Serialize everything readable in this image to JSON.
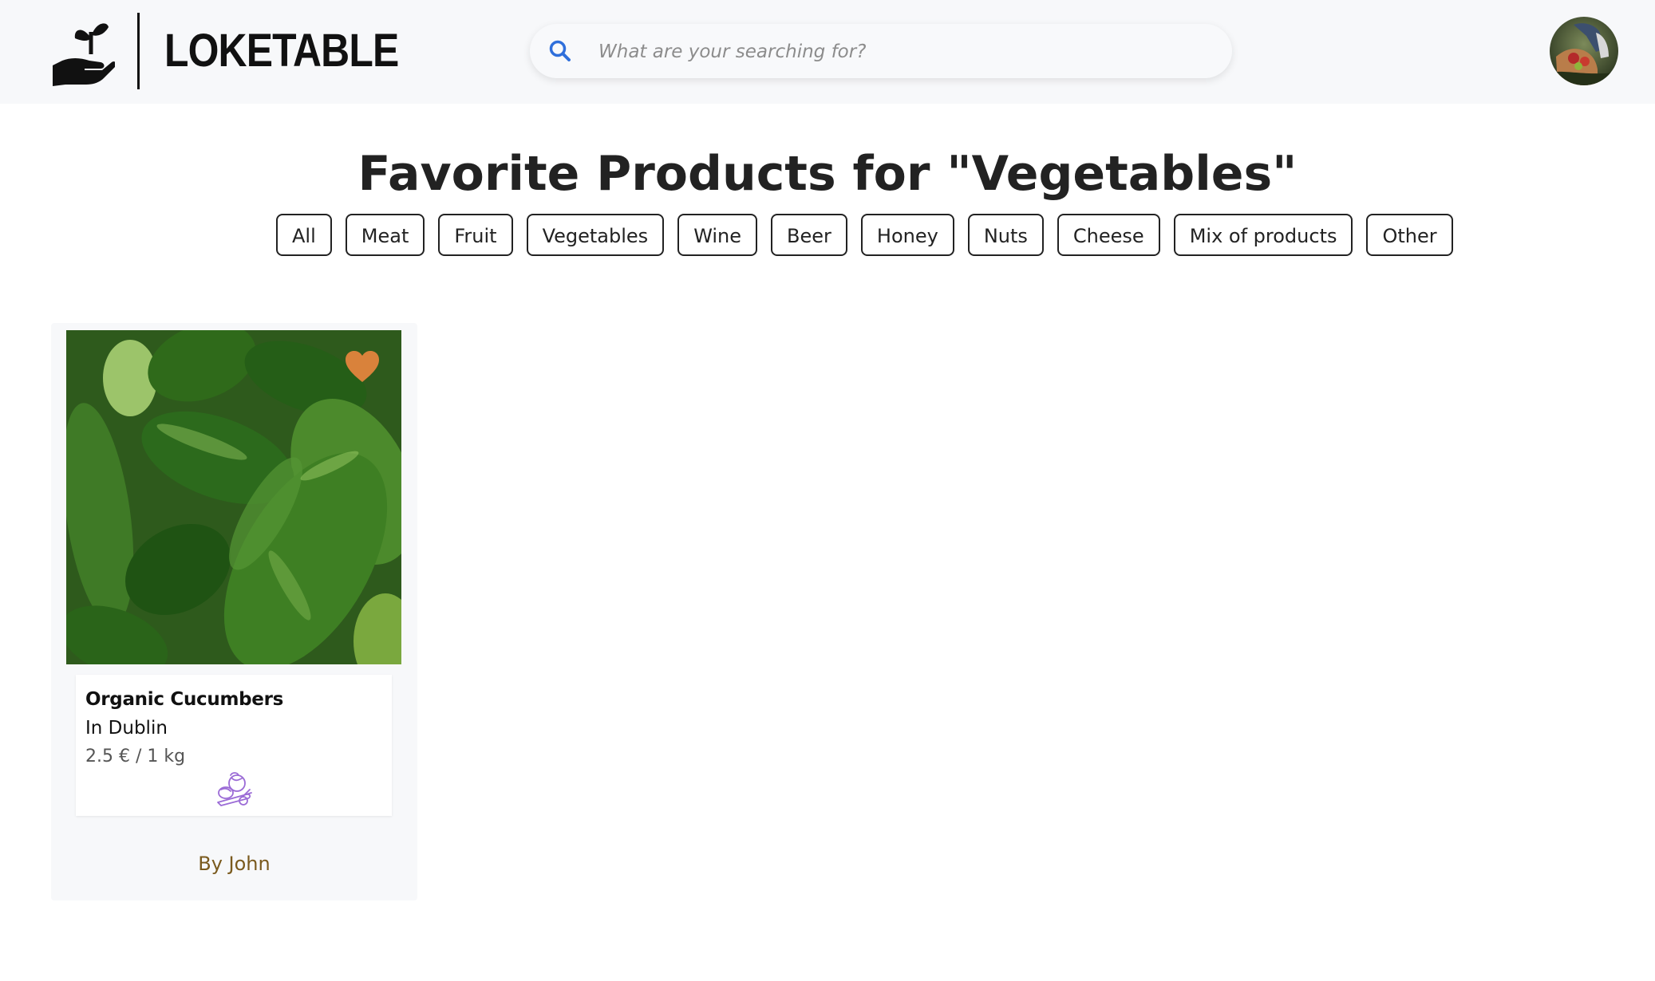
{
  "header": {
    "logo_text": "LOKETABLE",
    "search_placeholder": "What are your searching for?"
  },
  "page": {
    "title": "Favorite Products for \"Vegetables\""
  },
  "filters": [
    "All",
    "Meat",
    "Fruit",
    "Vegetables",
    "Wine",
    "Beer",
    "Honey",
    "Nuts",
    "Cheese",
    "Mix of products",
    "Other"
  ],
  "products": [
    {
      "name": "Organic Cucumbers",
      "location": "In Dublin",
      "price": "2.5 € / 1 kg",
      "seller": "By John",
      "favorite": true,
      "category_icon": "vegetables-icon"
    }
  ],
  "colors": {
    "favorite": "#d9823b",
    "category_icon": "#9b6bd6",
    "seller": "#7a5a1e",
    "search_icon": "#2f6fdb"
  }
}
